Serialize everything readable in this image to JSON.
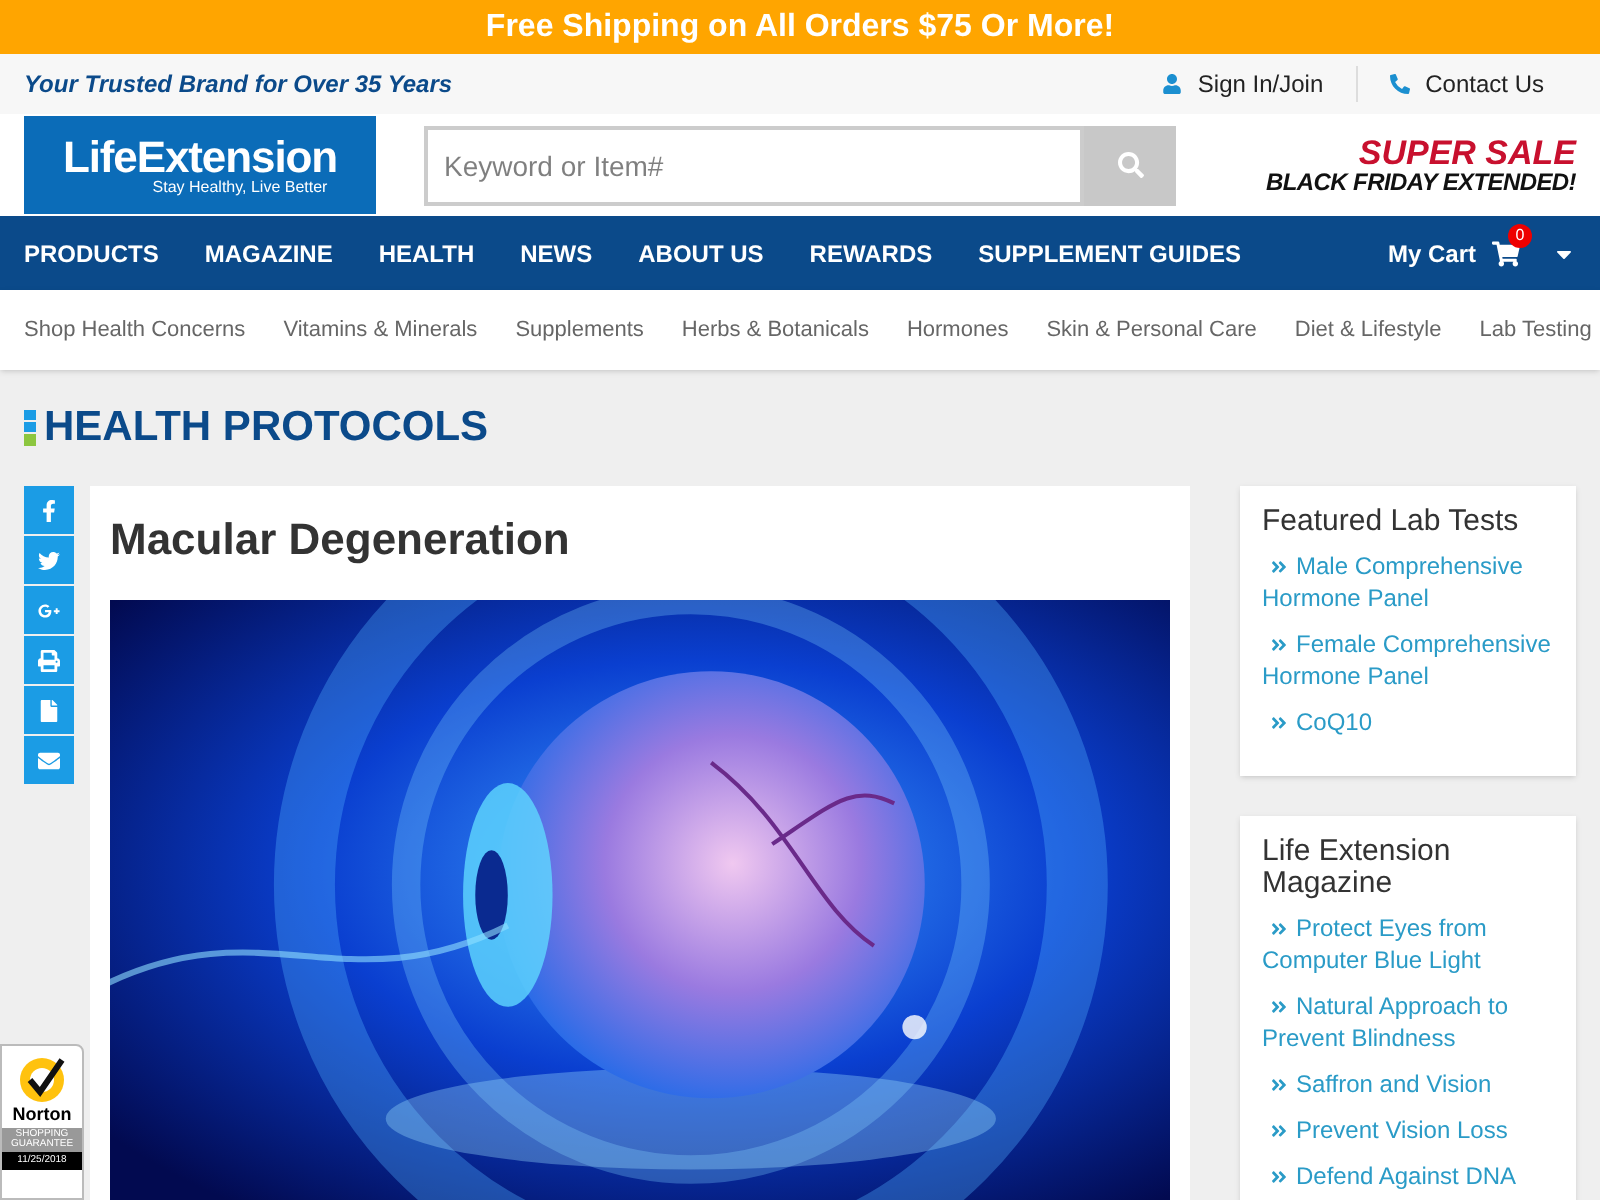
{
  "promo_bar": {
    "text": "Free Shipping on All Orders $75 Or More!"
  },
  "top_bar": {
    "tagline": "Your Trusted Brand for Over 35 Years",
    "links": [
      {
        "kind": "user",
        "label": "Sign In/Join"
      },
      {
        "kind": "phone",
        "label": "Contact Us"
      }
    ]
  },
  "header": {
    "logo": {
      "name": "LifeExtension",
      "tagline": "Stay Healthy, Live Better"
    },
    "search": {
      "placeholder": "Keyword or Item#"
    },
    "banner": {
      "line_1": "SUPER SALE",
      "line_2": "BLACK FRIDAY EXTENDED!"
    }
  },
  "main_nav": {
    "items": [
      "PRODUCTS",
      "MAGAZINE",
      "HEALTH",
      "NEWS",
      "ABOUT US",
      "REWARDS",
      "SUPPLEMENT GUIDES"
    ],
    "cart": {
      "label": "My Cart",
      "count": "0"
    }
  },
  "sub_nav": {
    "items": [
      "Shop Health Concerns",
      "Vitamins & Minerals",
      "Supplements",
      "Herbs & Botanicals",
      "Hormones",
      "Skin & Personal Care",
      "Diet & Lifestyle",
      "Lab Testing"
    ]
  },
  "section_title": "HEALTH PROTOCOLS",
  "share_buttons": [
    {
      "kind": "facebook"
    },
    {
      "kind": "twitter"
    },
    {
      "kind": "google"
    },
    {
      "kind": "print"
    },
    {
      "kind": "document"
    },
    {
      "kind": "email"
    }
  ],
  "article": {
    "title": "Macular Degeneration"
  },
  "sidebar": [
    {
      "title": "Featured Lab Tests",
      "links": [
        "Male Comprehensive Hormone Panel",
        "Female Comprehensive Hormone Panel",
        "CoQ10"
      ]
    },
    {
      "title": "Life Extension Magazine",
      "links": [
        "Protect Eyes from Computer Blue Light",
        "Natural Approach to Prevent Blindness",
        "Saffron and Vision",
        "Prevent Vision Loss",
        "Defend Against DNA"
      ]
    }
  ],
  "norton_badge": {
    "name": "Norton",
    "label": "SHOPPING GUARANTEE",
    "date": "11/25/2018"
  }
}
